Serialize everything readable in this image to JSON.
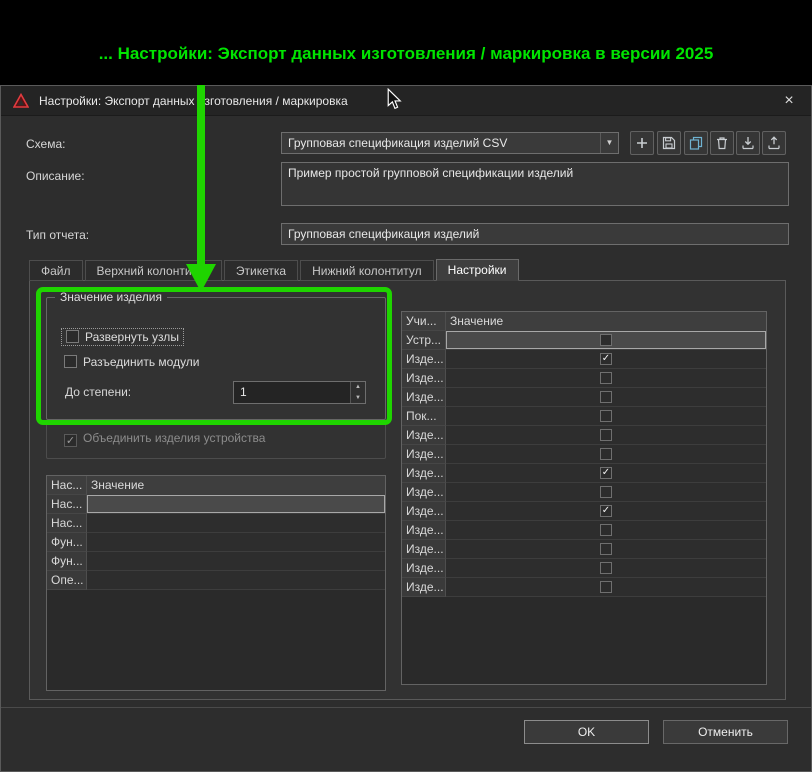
{
  "colors": {
    "annotation_green": "#1fd400",
    "banner_green": "#00e400",
    "logo_red": "#e23b3f"
  },
  "banner": {
    "text": "... Настройки: Экспорт данных изготовления / маркировка в версии 2025"
  },
  "window": {
    "title": "Настройки: Экспорт данных изготовления / маркировка",
    "close_glyph": "×"
  },
  "form": {
    "schema": {
      "label": "Схема:",
      "value": "Групповая спецификация изделий CSV"
    },
    "description": {
      "label": "Описание:",
      "value": "Пример простой групповой спецификации изделий"
    },
    "report_type": {
      "label": "Тип отчета:",
      "value": "Групповая спецификация изделий"
    }
  },
  "toolbar": {
    "buttons": [
      "plus-icon",
      "save-icon",
      "copy-icon",
      "delete-icon",
      "import-icon",
      "export-icon"
    ]
  },
  "tabs": {
    "items": [
      {
        "label": "Файл",
        "active": false
      },
      {
        "label": "Верхний колонтитул",
        "active": false
      },
      {
        "label": "Этикетка",
        "active": false
      },
      {
        "label": "Нижний колонтитул",
        "active": false
      },
      {
        "label": "Настройки",
        "active": true
      }
    ]
  },
  "settings": {
    "product_group": {
      "title": "Значение изделия",
      "expand_nodes": {
        "label": "Развернуть узлы",
        "checked": false,
        "focused": true
      },
      "split_modules": {
        "label": "Разъединить модули",
        "checked": false
      },
      "depth": {
        "label": "До степени:",
        "value": "1"
      }
    },
    "merge_devices": {
      "label": "Объединить изделия устройства",
      "checked": true,
      "disabled": true
    }
  },
  "left_table": {
    "columns": [
      "Нас...",
      "Значение"
    ],
    "rows": [
      {
        "name": "Нас...",
        "value": "",
        "selected": true
      },
      {
        "name": "Нас...",
        "value": "",
        "selected": false
      },
      {
        "name": "Фун...",
        "value": "",
        "selected": false
      },
      {
        "name": "Фун...",
        "value": "",
        "selected": false
      },
      {
        "name": "Опе...",
        "value": "",
        "selected": false
      }
    ]
  },
  "right_table": {
    "columns": [
      "Учи...",
      "Значение"
    ],
    "rows": [
      {
        "name": "Устр...",
        "checked": false,
        "selected": true
      },
      {
        "name": "Изде...",
        "checked": true,
        "selected": false
      },
      {
        "name": "Изде...",
        "checked": false,
        "selected": false
      },
      {
        "name": "Изде...",
        "checked": false,
        "selected": false
      },
      {
        "name": "Пок...",
        "checked": false,
        "selected": false
      },
      {
        "name": "Изде...",
        "checked": false,
        "selected": false
      },
      {
        "name": "Изде...",
        "checked": false,
        "selected": false
      },
      {
        "name": "Изде...",
        "checked": true,
        "selected": false
      },
      {
        "name": "Изде...",
        "checked": false,
        "selected": false
      },
      {
        "name": "Изде...",
        "checked": true,
        "selected": false
      },
      {
        "name": "Изде...",
        "checked": false,
        "selected": false
      },
      {
        "name": "Изде...",
        "checked": false,
        "selected": false
      },
      {
        "name": "Изде...",
        "checked": false,
        "selected": false
      },
      {
        "name": "Изде...",
        "checked": false,
        "selected": false
      }
    ]
  },
  "footer": {
    "ok": "OK",
    "cancel": "Отменить"
  }
}
